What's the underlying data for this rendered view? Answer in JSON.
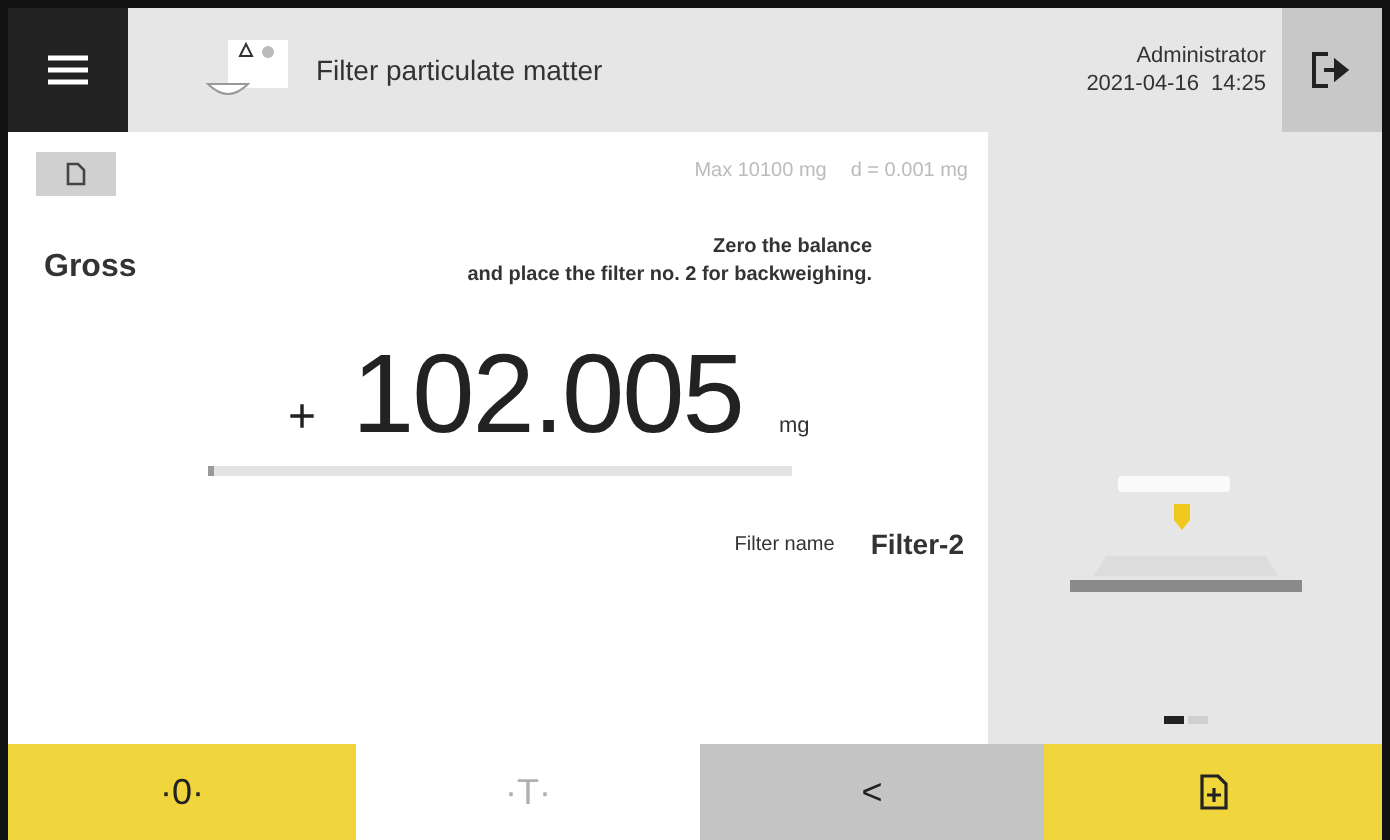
{
  "header": {
    "title": "Filter particulate matter",
    "user": "Administrator",
    "date": "2021-04-16",
    "time": "14:25"
  },
  "info": {
    "max": "Max 10100 mg",
    "d": "d = 0.001 mg"
  },
  "weighing": {
    "mode": "Gross",
    "instruction": "Zero the balance\nand place the filter no. 2 for backweighing.",
    "sign": "+",
    "value": "102.005",
    "unit": "mg",
    "level": 0.01
  },
  "field": {
    "label": "Filter name",
    "value": "Filter-2"
  },
  "pages": [
    {
      "selected": true
    },
    {
      "selected": false
    }
  ],
  "buttons": [
    {
      "kind": "primary",
      "label": "·0·",
      "disabled": false
    },
    {
      "kind": "plain",
      "label": "·T·",
      "disabled": true
    },
    {
      "kind": "secondary",
      "label": "<",
      "disabled": false
    },
    {
      "kind": "primary-icon",
      "disabled": false
    }
  ]
}
